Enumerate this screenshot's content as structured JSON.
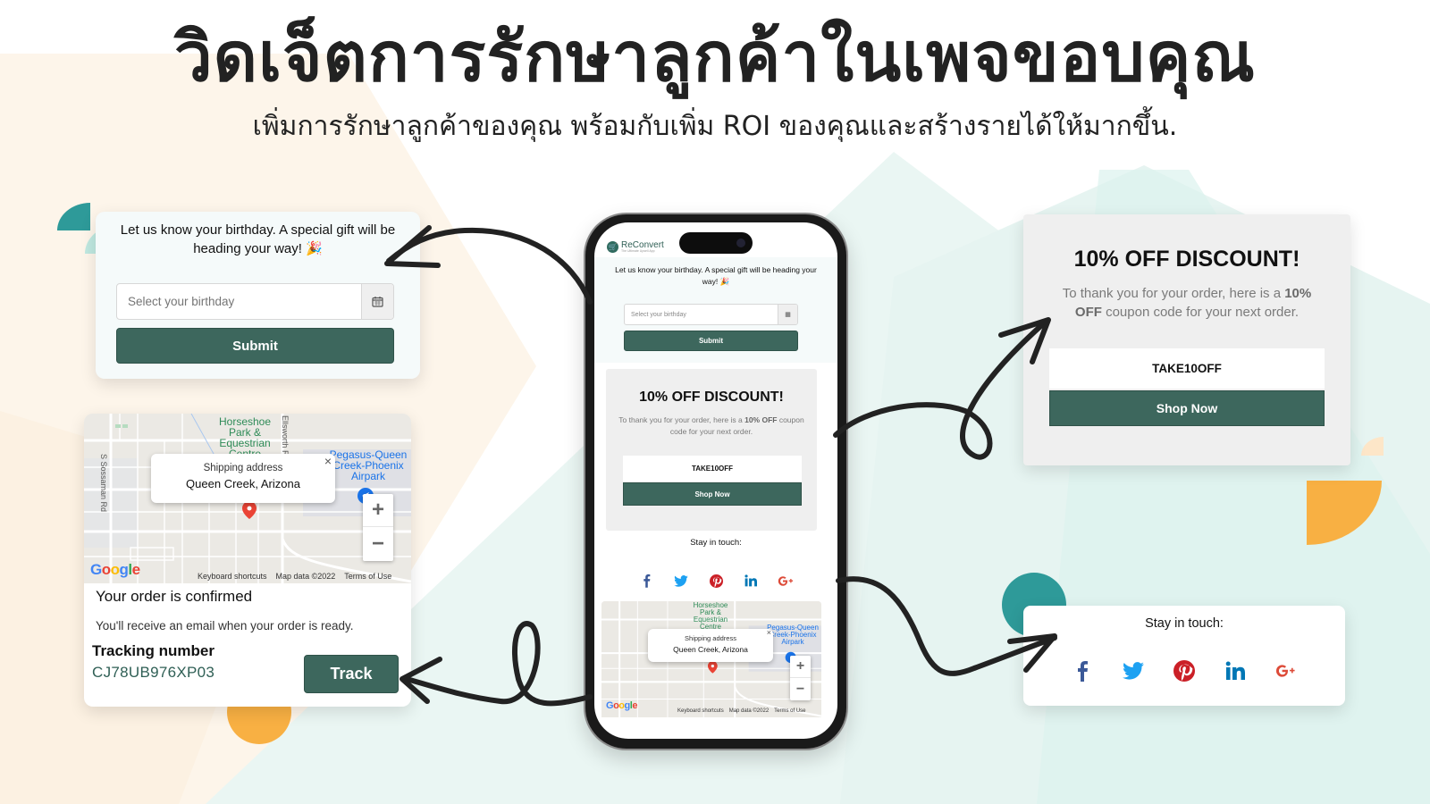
{
  "header": {
    "title": "วิดเจ็ตการรักษาลูกค้าในเพจขอบคุณ",
    "subtitle": "เพิ่มการรักษาลูกค้าของคุณ พร้อมกับเพิ่ม ROI ของคุณและสร้างรายได้ให้มากขึ้น."
  },
  "colors": {
    "brand_green": "#3d675d",
    "tracking_text": "#2f5f55",
    "teal_shape": "#2e9a99",
    "mint_shape": "#bfe8e0",
    "orange_shape": "#f8b043",
    "peach_bg": "#fdf4e8",
    "mint_bg": "#e8f6f3"
  },
  "birthday_widget": {
    "message": "Let us know your birthday. A special gift will be heading your way! 🎉",
    "input_placeholder": "Select your birthday",
    "calendar_icon": "calendar-icon",
    "submit_label": "Submit"
  },
  "map_widget": {
    "popup_label": "Shipping address",
    "popup_value": "Queen Creek, Arizona",
    "place_park": "Horseshoe Park & Equestrian Centre",
    "place_airpark": "Pegasus-Queen Creek-Phoenix Airpark",
    "road_sossaman": "S Sossaman Rd",
    "road_ellsworth": "Ellsworth Rd",
    "zoom_in": "+",
    "zoom_out": "−",
    "close": "×",
    "google": [
      "G",
      "o",
      "o",
      "g",
      "l",
      "e"
    ],
    "footer": [
      "Keyboard shortcuts",
      "Map data ©2022",
      "Terms of Use"
    ]
  },
  "order_widget": {
    "title": "Your order is confirmed",
    "subtitle": "You'll receive an email when your order is ready.",
    "tracking_label": "Tracking number",
    "tracking_number": "CJ78UB976XP03",
    "track_button": "Track"
  },
  "discount_widget": {
    "title": "10% OFF DISCOUNT!",
    "text_before": "To thank you for your order, here is a ",
    "text_bold": "10% OFF",
    "text_after": " coupon code for your next order.",
    "coupon_code": "TAKE10OFF",
    "shop_button": "Shop Now"
  },
  "social_widget": {
    "title": "Stay in touch:",
    "networks": [
      {
        "name": "facebook",
        "glyph": "f",
        "color": "#3b5998"
      },
      {
        "name": "twitter",
        "glyph": "🐦",
        "color": "#1da1f2"
      },
      {
        "name": "pinterest",
        "glyph": "P",
        "color": "#cb2027"
      },
      {
        "name": "linkedin",
        "glyph": "in",
        "color": "#0077b5"
      },
      {
        "name": "google-plus",
        "glyph": "G+",
        "color": "#dd4b39"
      }
    ]
  },
  "phone": {
    "app_name": "ReConvert",
    "app_tagline": "The Ultimate Upsell App"
  }
}
